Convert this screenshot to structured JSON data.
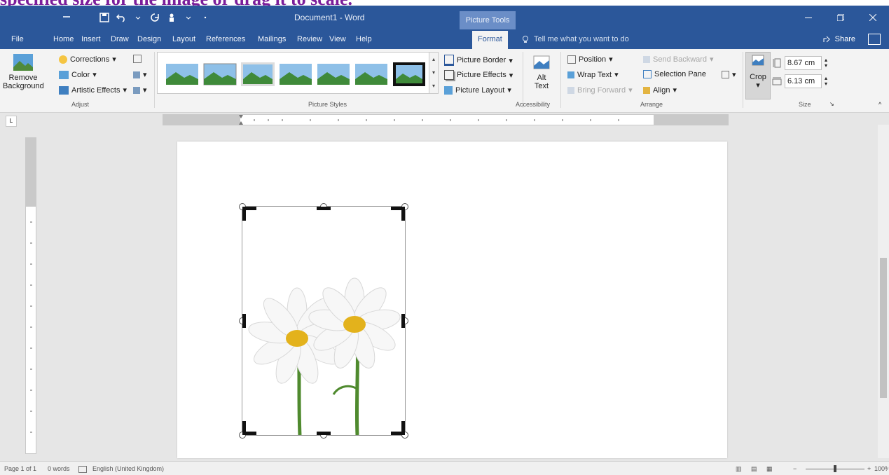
{
  "caption": {
    "text": "specified size for the image or drag it to scale."
  },
  "window": {
    "title": "Document1 - Word",
    "context_tab": "Picture Tools"
  },
  "tabs": [
    {
      "label": "File"
    },
    {
      "label": "Home"
    },
    {
      "label": "Insert"
    },
    {
      "label": "Draw"
    },
    {
      "label": "Design"
    },
    {
      "label": "Layout"
    },
    {
      "label": "References"
    },
    {
      "label": "Mailings"
    },
    {
      "label": "Review"
    },
    {
      "label": "View"
    },
    {
      "label": "Help"
    },
    {
      "label": "Format"
    }
  ],
  "tell_me": "Tell me what you want to do",
  "share": "Share",
  "ribbon": {
    "adjust": {
      "remove_background_1": "Remove",
      "remove_background_2": "Background",
      "corrections": "Corrections",
      "color": "Color",
      "artistic_effects": "Artistic Effects",
      "label": "Adjust"
    },
    "picture_styles": {
      "border": "Picture Border",
      "effects": "Picture Effects",
      "layout": "Picture Layout",
      "label": "Picture Styles"
    },
    "accessibility": {
      "alt_text_1": "Alt",
      "alt_text_2": "Text",
      "label": "Accessibility"
    },
    "arrange": {
      "position": "Position",
      "wrap_text": "Wrap Text",
      "bring_forward": "Bring Forward",
      "send_backward": "Send Backward",
      "selection_pane": "Selection Pane",
      "align": "Align",
      "label": "Arrange"
    },
    "size": {
      "crop": "Crop",
      "height": "8.67 cm",
      "width": "6.13 cm",
      "label": "Size"
    }
  },
  "status": {
    "page": "Page 1 of 1",
    "words": "0 words",
    "language": "English (United Kingdom)",
    "zoom": "100%"
  },
  "colors": {
    "word_blue": "#2b579a",
    "caption_purple": "#7b1e9a"
  }
}
